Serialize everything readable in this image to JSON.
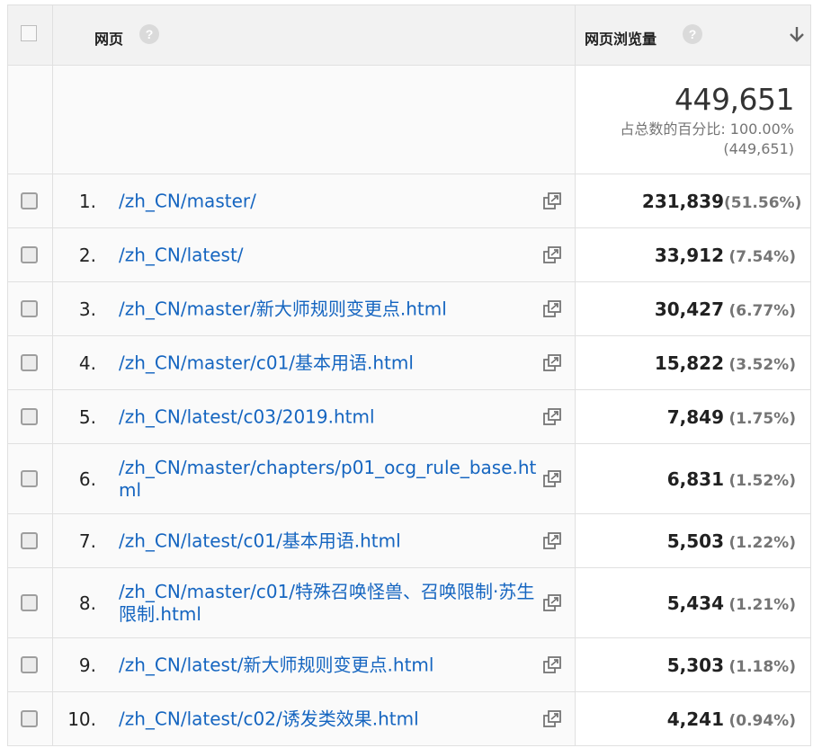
{
  "header": {
    "page_label": "网页",
    "views_label": "网页浏览量",
    "help_glyph": "?",
    "sort_icon": "arrow-down-icon"
  },
  "summary": {
    "total": "449,651",
    "pct_label": "占总数的百分比: 100.00%",
    "pct_total": "(449,651)"
  },
  "rows": [
    {
      "index": "1.",
      "path": "/zh_CN/master/",
      "views": "231,839",
      "pct": "(51.56%)"
    },
    {
      "index": "2.",
      "path": "/zh_CN/latest/",
      "views": "33,912",
      "pct": "(7.54%)"
    },
    {
      "index": "3.",
      "path": "/zh_CN/master/新大师规则变更点.html",
      "views": "30,427",
      "pct": "(6.77%)"
    },
    {
      "index": "4.",
      "path": "/zh_CN/master/c01/基本用语.html",
      "views": "15,822",
      "pct": "(3.52%)"
    },
    {
      "index": "5.",
      "path": "/zh_CN/latest/c03/2019.html",
      "views": "7,849",
      "pct": "(1.75%)"
    },
    {
      "index": "6.",
      "path": "/zh_CN/master/chapters/p01_ocg_rule_base.html",
      "views": "6,831",
      "pct": "(1.52%)"
    },
    {
      "index": "7.",
      "path": "/zh_CN/latest/c01/基本用语.html",
      "views": "5,503",
      "pct": "(1.22%)"
    },
    {
      "index": "8.",
      "path": "/zh_CN/master/c01/特殊召唤怪兽、召唤限制·苏生限制.html",
      "views": "5,434",
      "pct": "(1.21%)"
    },
    {
      "index": "9.",
      "path": "/zh_CN/latest/新大师规则变更点.html",
      "views": "5,303",
      "pct": "(1.18%)"
    },
    {
      "index": "10.",
      "path": "/zh_CN/latest/c02/诱发类效果.html",
      "views": "4,241",
      "pct": "(0.94%)"
    }
  ],
  "colors": {
    "link": "#1565c0",
    "header_bg": "#f2f2f2",
    "row_bg": "#fafafa",
    "muted": "#757575"
  }
}
